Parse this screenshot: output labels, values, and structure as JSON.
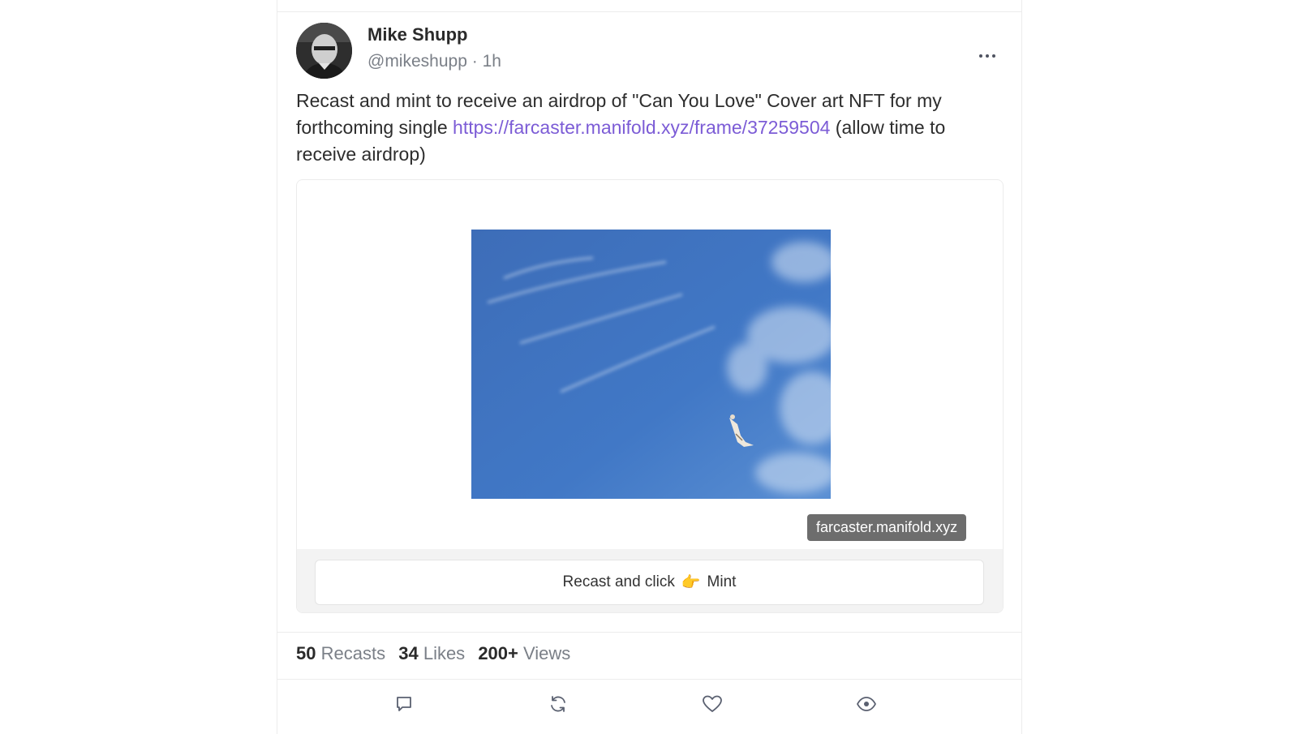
{
  "post": {
    "author_name": "Mike Shupp",
    "author_handle": "@mikeshupp",
    "separator": "·",
    "time": "1h",
    "text_before_link": "Recast and mint to receive an airdrop of \"Can You Love\" Cover art NFT for my forthcoming single ",
    "link": "https://farcaster.manifold.xyz/frame/37259504",
    "text_after_link": " (allow time to receive airdrop)"
  },
  "frame": {
    "domain": "farcaster.manifold.xyz",
    "button_prefix": "Recast and click",
    "button_emoji": "👉",
    "button_suffix": "Mint"
  },
  "stats": {
    "recasts_count": "50",
    "recasts_label": "Recasts",
    "likes_count": "34",
    "likes_label": "Likes",
    "views_count": "200+",
    "views_label": "Views"
  },
  "icons": {
    "more": "more-dots-icon",
    "reply": "comment-icon",
    "recast": "recast-icon",
    "like": "heart-icon",
    "views": "eye-icon"
  },
  "colors": {
    "link": "#7c5cd6",
    "sky": "#3f73c2",
    "domain_chip": "#6d6d6d"
  }
}
